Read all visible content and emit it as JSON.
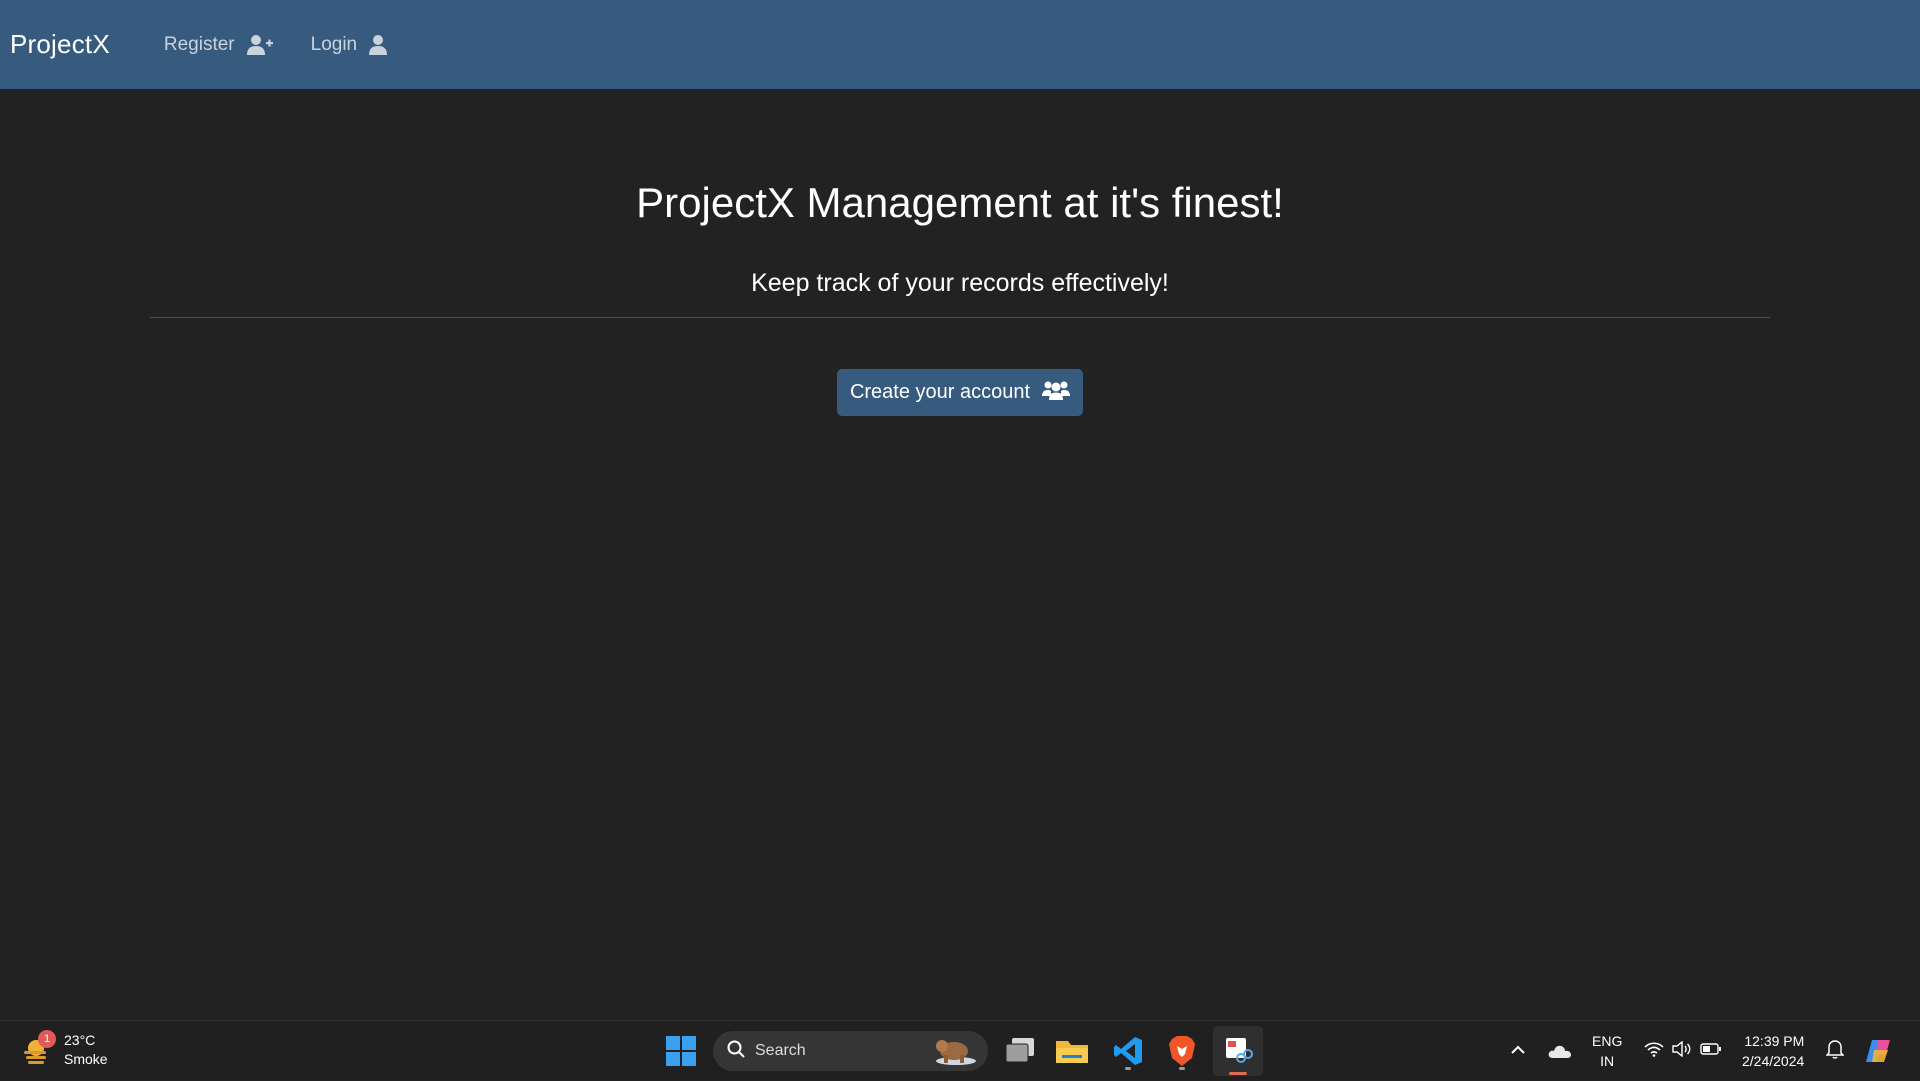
{
  "navbar": {
    "brand": "ProjectX",
    "links": [
      {
        "label": "Register",
        "icon": "user-plus-icon"
      },
      {
        "label": "Login",
        "icon": "user-icon"
      }
    ],
    "color": "#375a7f"
  },
  "hero": {
    "title": "ProjectX Management at it's finest!",
    "subtitle": "Keep track of your records effectively!",
    "cta_label": "Create your account",
    "cta_icon": "users-icon"
  },
  "taskbar": {
    "weather": {
      "temp": "23°C",
      "condition": "Smoke",
      "badge": "1"
    },
    "search_label": "Search",
    "apps": [
      "start-icon",
      "task-view-icon",
      "file-explorer-icon",
      "vscode-icon",
      "brave-icon",
      "snipping-tool-icon"
    ],
    "language": {
      "line1": "ENG",
      "line2": "IN"
    },
    "time": "12:39 PM",
    "date": "2/24/2024"
  }
}
